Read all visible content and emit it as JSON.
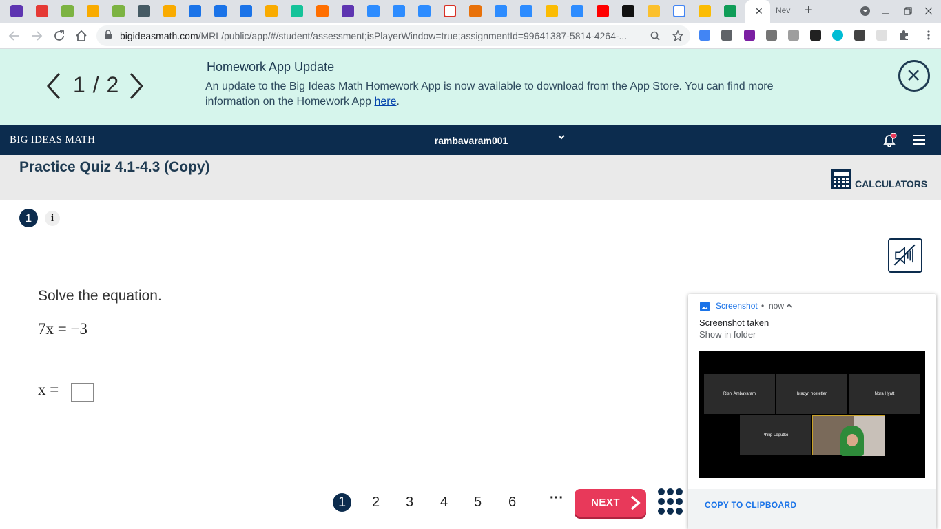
{
  "browser": {
    "active_tab_close": "✕",
    "new_tab_label": "Nev",
    "new_tab_button": "+",
    "url_domain": "bigideasmath.com",
    "url_path": "/MRL/public/app/#/student/assessment;isPlayerWindow=true;assignmentId=99641387-5814-4264-..."
  },
  "banner": {
    "pager": "1 / 2",
    "title": "Homework App Update",
    "body_text": "An update to the Big Ideas Math Homework App is now available to download from the App Store. You can find more information on the Homework App ",
    "link_text": "here",
    "body_end": "."
  },
  "header": {
    "brand": "BIG IDEAS MATH",
    "username": "rambavaram001"
  },
  "quiz": {
    "title": "Practice Quiz 4.1-4.3 (Copy)",
    "calculators_label": "CALCULATORS",
    "question_number": "1",
    "info_label": "i",
    "instruction": "Solve the equation.",
    "equation": "7x = −3",
    "answer_label": "x =",
    "answer_value": ""
  },
  "navigation": {
    "questions": [
      "1",
      "2",
      "3",
      "4",
      "5",
      "6"
    ],
    "current": "1",
    "ellipsis": "···",
    "next_label": "NEXT"
  },
  "notification": {
    "app": "Screenshot",
    "dot": "•",
    "time": "now",
    "title": "Screenshot taken",
    "subtitle": "Show in folder",
    "participants": [
      "Rishi Ambavaram",
      "bradyn hostetler",
      "Nora Hyatt",
      "Philip Legutko"
    ],
    "copy_button": "COPY TO CLIPBOARD"
  }
}
